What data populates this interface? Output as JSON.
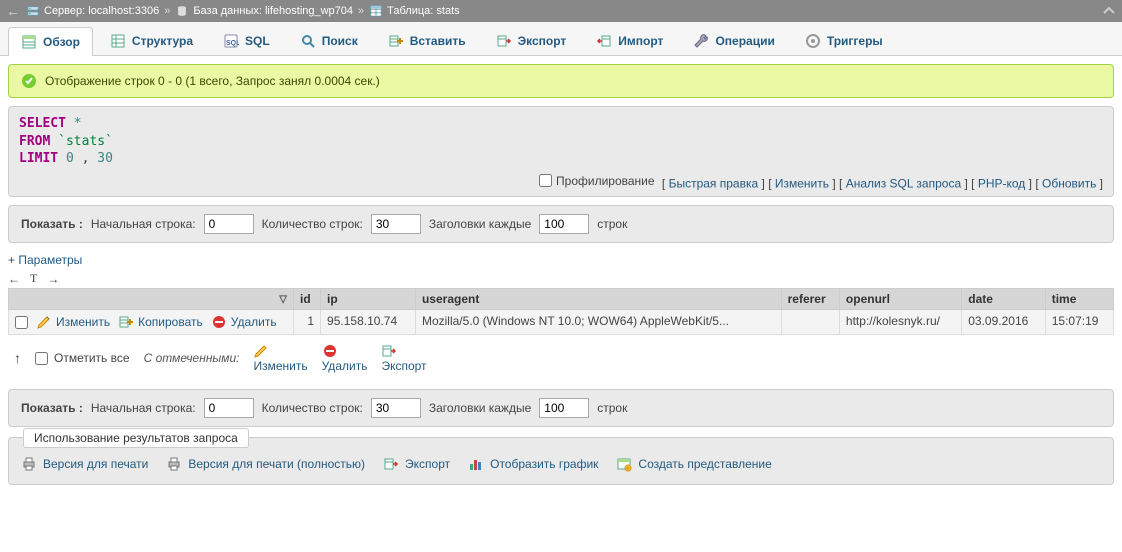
{
  "breadcrumb": {
    "server_label": "Сервер: localhost:3306",
    "db_label": "База данных: lifehosting_wp704",
    "table_label": "Таблица: stats"
  },
  "tabs": [
    {
      "key": "browse",
      "label": "Обзор"
    },
    {
      "key": "structure",
      "label": "Структура"
    },
    {
      "key": "sql",
      "label": "SQL"
    },
    {
      "key": "search",
      "label": "Поиск"
    },
    {
      "key": "insert",
      "label": "Вставить"
    },
    {
      "key": "export",
      "label": "Экспорт"
    },
    {
      "key": "import",
      "label": "Импорт"
    },
    {
      "key": "operations",
      "label": "Операции"
    },
    {
      "key": "triggers",
      "label": "Триггеры"
    }
  ],
  "success_text": "Отображение строк 0 - 0 (1 всего, Запрос занял 0.0004 сек.)",
  "sql": {
    "select": "SELECT",
    "star": "*",
    "from": "FROM",
    "ident": "`stats`",
    "limit": "LIMIT",
    "limit_a": "0",
    "limit_comma": ",",
    "limit_b": "30"
  },
  "query_links": {
    "profiling": "Профилирование",
    "quick_edit": "Быстрая правка",
    "edit": "Изменить",
    "analyze": "Анализ SQL запроса",
    "php": "PHP-код",
    "refresh": "Обновить"
  },
  "show_row": {
    "show": "Показать :",
    "start_label": "Начальная строка:",
    "start_value": "0",
    "count_label": "Количество строк:",
    "count_value": "30",
    "headers_label": "Заголовки каждые",
    "headers_value": "100",
    "rows_word": "строк"
  },
  "options_link": "+ Параметры",
  "columns": {
    "id": "id",
    "ip": "ip",
    "useragent": "useragent",
    "referer": "referer",
    "openurl": "openurl",
    "date": "date",
    "time": "time"
  },
  "row_actions": {
    "edit": "Изменить",
    "copy": "Копировать",
    "delete": "Удалить"
  },
  "row": {
    "id": "1",
    "ip": "95.158.10.74",
    "useragent": "Mozilla/5.0 (Windows NT 10.0; WOW64) AppleWebKit/5...",
    "referer": "",
    "openurl": "http://kolesnyk.ru/",
    "date": "03.09.2016",
    "time": "15:07:19"
  },
  "below": {
    "check_all": "Отметить все",
    "with_marked": "С отмеченными:",
    "edit": "Изменить",
    "delete": "Удалить",
    "export": "Экспорт"
  },
  "usage": {
    "title": "Использование результатов запроса",
    "print": "Версия для печати",
    "print_full": "Версия для печати (полностью)",
    "export": "Экспорт",
    "chart": "Отобразить график",
    "create_view": "Создать представление"
  }
}
